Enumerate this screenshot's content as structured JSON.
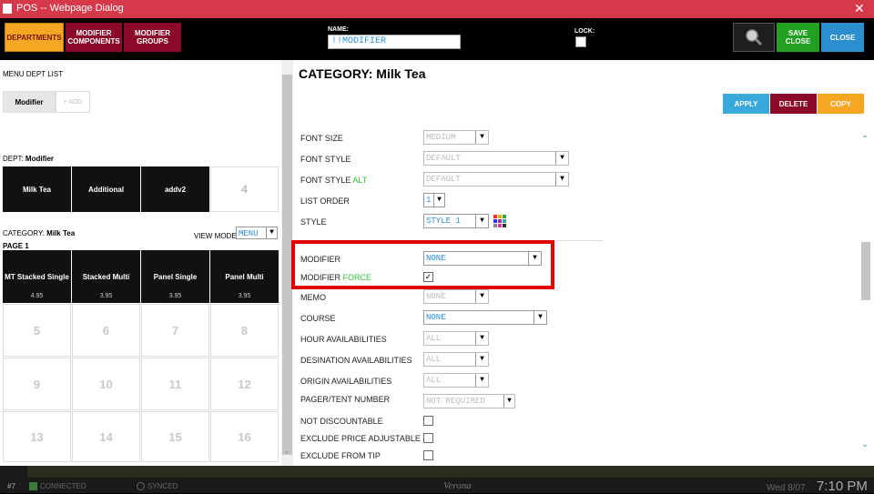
{
  "window": {
    "title": "POS -- Webpage Dialog",
    "close": "✕"
  },
  "toolbar": {
    "departments": "DEPARTMENTS",
    "modifier_components": "MODIFIER COMPONENTS",
    "modifier_groups": "MODIFIER GROUPS",
    "name_label": "NAME:",
    "name_value": "!!MODIFIER",
    "lock_label": "LOCK:",
    "save_close": "SAVE CLOSE",
    "close": "CLOSE"
  },
  "left": {
    "menu_dept_list": "MENU DEPT LIST",
    "tab_modifier": "Modifier",
    "tab_add": "+ ADD",
    "dept_label": "DEPT:",
    "dept_value": "Modifier",
    "depts": [
      "Milk Tea",
      "Additional",
      "addv2"
    ],
    "dept_empty": "4",
    "category_label": "CATEGORY:",
    "category_value": "Milk Tea",
    "view_mode_label": "VIEW MODE:",
    "view_mode_value": "MENU",
    "page_label": "PAGE 1",
    "items": [
      {
        "name": "MT Stacked Single",
        "price": "4.95"
      },
      {
        "name": "Stacked Multi",
        "price": "3.95"
      },
      {
        "name": "Panel Single",
        "price": "3.95"
      },
      {
        "name": "Panel Multi",
        "price": "3.95"
      }
    ],
    "empty_slots": [
      "5",
      "6",
      "7",
      "8",
      "9",
      "10",
      "11",
      "12",
      "13",
      "14",
      "15",
      "16"
    ]
  },
  "right": {
    "title": "CATEGORY: Milk Tea",
    "apply": "APPLY",
    "delete": "DELETE",
    "copy": "COPY",
    "fields": {
      "font_size": {
        "label": "FONT SIZE",
        "value": "MEDIUM"
      },
      "font_style": {
        "label": "FONT STYLE",
        "value": "DEFAULT"
      },
      "font_style_alt": {
        "label": "FONT STYLE",
        "label_alt": "ALT",
        "value": "DEFAULT"
      },
      "list_order": {
        "label": "LIST ORDER",
        "value": "1"
      },
      "style": {
        "label": "STYLE",
        "value": "STYLE 1"
      },
      "modifier": {
        "label": "MODIFIER",
        "value": "NONE"
      },
      "modifier_force": {
        "label": "MODIFIER",
        "label_alt": "FORCE",
        "checked": "✓"
      },
      "memo": {
        "label": "MEMO",
        "value": "NONE"
      },
      "course": {
        "label": "COURSE",
        "value": "NONE"
      },
      "hour_avail": {
        "label": "HOUR AVAILABILITIES",
        "value": "ALL"
      },
      "dest_avail": {
        "label": "DESINATION AVAILABILITIES",
        "value": "ALL"
      },
      "origin_avail": {
        "label": "ORIGIN AVAILABILITIES",
        "value": "ALL"
      },
      "pager": {
        "label": "PAGER/TENT NUMBER",
        "value": "NOT REQUIRED"
      },
      "not_discountable": {
        "label": "NOT DISCOUNTABLE"
      },
      "exclude_price": {
        "label": "EXCLUDE PRICE ADJUSTABLE"
      },
      "exclude_tip": {
        "label": "EXCLUDE FROM TIP"
      }
    }
  },
  "status": {
    "station": "#7",
    "connected": "CONNECTED",
    "synced": "SYNCED",
    "location": "Verona",
    "date": "Wed 8/07",
    "time": "7:10 PM"
  },
  "colors": {
    "orange": "#f5a623",
    "maroon": "#8b0a2a",
    "blue": "#2b8fcf",
    "green": "#22a022",
    "apply": "#39a9dc",
    "red_highlight": "#e00000"
  }
}
